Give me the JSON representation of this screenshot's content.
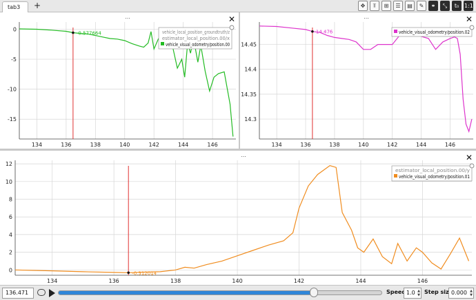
{
  "tabs": [
    {
      "label": "tab3"
    }
  ],
  "tab_add_label": "+",
  "toolbar": [
    {
      "name": "move-icon",
      "glyph": "✥"
    },
    {
      "name": "reference-line-icon",
      "glyph": "⫪"
    },
    {
      "name": "grid-icon",
      "glyph": "⊞"
    },
    {
      "name": "legend-icon",
      "glyph": "☰"
    },
    {
      "name": "save-layout-icon",
      "glyph": "▤"
    },
    {
      "name": "settings-icon",
      "glyph": "✎"
    },
    {
      "name": "link-icon",
      "glyph": "⚭"
    },
    {
      "name": "zoom-out-icon",
      "glyph": "⤡"
    },
    {
      "name": "time-offset-icon",
      "glyph": "t₀"
    },
    {
      "name": "ratio-icon",
      "glyph": "1:1"
    }
  ],
  "colors": {
    "green": "#22bb22",
    "magenta": "#dd33cc",
    "orange": "#f08c1e",
    "tracker": "#e03030",
    "grid": "#d6d6d6"
  },
  "chart_data": [
    {
      "type": "line",
      "pane_title": "...",
      "legend": [
        "vehicle_local_position_groundtruth/z",
        "estimator_local_position.00/x",
        "vehicle_visual_odometry/position.00"
      ],
      "tracker_value": "-0.577664",
      "tracker_x": 136.471,
      "xlim": [
        132.8,
        147.6
      ],
      "ylim": [
        -18.3,
        1.2
      ],
      "xticks": [
        "134",
        "136",
        "138",
        "140",
        "142",
        "144",
        "146"
      ],
      "yticks": [
        "0",
        "-5",
        "-10",
        "-15"
      ],
      "series": [
        {
          "color": "#22bb22",
          "x": [
            132.8,
            134,
            135,
            136,
            136.47,
            137,
            137.5,
            138,
            138.5,
            139,
            139.5,
            140,
            140.5,
            141,
            141.3,
            141.6,
            141.8,
            142,
            142.3,
            142.6,
            143,
            143.3,
            143.6,
            143.9,
            144.1,
            144.3,
            144.5,
            144.7,
            145,
            145.2,
            145.5,
            145.8,
            146.1,
            146.4,
            146.8,
            147.2,
            147.4
          ],
          "values": [
            0.05,
            0.0,
            -0.15,
            -0.35,
            -0.58,
            -0.7,
            -0.8,
            -1.05,
            -1.3,
            -1.55,
            -1.65,
            -1.9,
            -2.4,
            -2.8,
            -3.0,
            -2.3,
            -0.4,
            -3.3,
            -1.6,
            -1.8,
            -2.5,
            -3.2,
            -6.5,
            -5.0,
            -8.0,
            -2.3,
            -4.0,
            -1.5,
            -5.5,
            -2.7,
            -7.0,
            -10.3,
            -8.0,
            -7.4,
            -7.1,
            -12.5,
            -17.9
          ]
        }
      ]
    },
    {
      "type": "line",
      "pane_title": "...",
      "legend": [
        "vehicle_visual_odometry/position.02"
      ],
      "tracker_value": "14.476",
      "tracker_x": 136.471,
      "xlim": [
        132.8,
        147.6
      ],
      "ylim": [
        14.26,
        14.495
      ],
      "xticks": [
        "134",
        "136",
        "138",
        "140",
        "142",
        "144",
        "146"
      ],
      "yticks": [
        "14.45",
        "14.4",
        "14.35",
        "14.3"
      ],
      "series": [
        {
          "color": "#dd33cc",
          "x": [
            132.8,
            134,
            135,
            136,
            136.47,
            137,
            137.5,
            138,
            138.5,
            139,
            139.5,
            140,
            140.5,
            141,
            141.5,
            142,
            142.5,
            143,
            143.5,
            144,
            144.5,
            145,
            145.5,
            146,
            146.3,
            146.5,
            146.7,
            146.9,
            147.1,
            147.3,
            147.5
          ],
          "values": [
            14.487,
            14.486,
            14.483,
            14.48,
            14.476,
            14.474,
            14.468,
            14.464,
            14.462,
            14.46,
            14.455,
            14.44,
            14.44,
            14.45,
            14.45,
            14.45,
            14.468,
            14.482,
            14.477,
            14.466,
            14.462,
            14.44,
            14.455,
            14.462,
            14.465,
            14.462,
            14.43,
            14.34,
            14.29,
            14.275,
            14.3
          ]
        }
      ]
    },
    {
      "type": "line",
      "pane_title": "...",
      "legend": [
        "estimator_local_position.00/y",
        "vehicle_visual_odometry/position.01"
      ],
      "tracker_value": "-0.312014",
      "tracker_x": 136.471,
      "xlim": [
        132.8,
        147.6
      ],
      "ylim": [
        -0.6,
        12.4
      ],
      "xticks": [
        "134",
        "136",
        "138",
        "140",
        "142",
        "144",
        "146"
      ],
      "yticks": [
        "12",
        "10",
        "8",
        "6",
        "4",
        "2",
        "0"
      ],
      "series": [
        {
          "color": "#f08c1e",
          "x": [
            132.8,
            134,
            135,
            136,
            136.47,
            137,
            137.5,
            138,
            138.3,
            138.6,
            139,
            139.5,
            140,
            140.5,
            141,
            141.5,
            141.8,
            142,
            142.3,
            142.6,
            143,
            143.2,
            143.4,
            143.7,
            143.9,
            144.1,
            144.4,
            144.7,
            145,
            145.2,
            145.5,
            145.8,
            146,
            146.3,
            146.6,
            146.9,
            147.2,
            147.5
          ],
          "values": [
            0.0,
            -0.1,
            -0.2,
            -0.28,
            -0.31,
            -0.25,
            -0.2,
            0.0,
            0.3,
            0.2,
            0.6,
            1.0,
            1.6,
            2.2,
            2.8,
            3.3,
            4.2,
            7.0,
            9.5,
            10.8,
            11.8,
            11.6,
            6.5,
            4.5,
            2.5,
            2.0,
            3.5,
            1.5,
            0.7,
            3.0,
            1.0,
            2.5,
            2.0,
            0.8,
            0.1,
            1.8,
            3.6,
            1.0
          ]
        }
      ]
    }
  ],
  "bottom": {
    "time_value": "136.471",
    "slider_fraction": 0.79,
    "speed_label": "Speed:",
    "speed_value": "1.0",
    "step_label": "Step size:",
    "step_value": "0.000"
  }
}
